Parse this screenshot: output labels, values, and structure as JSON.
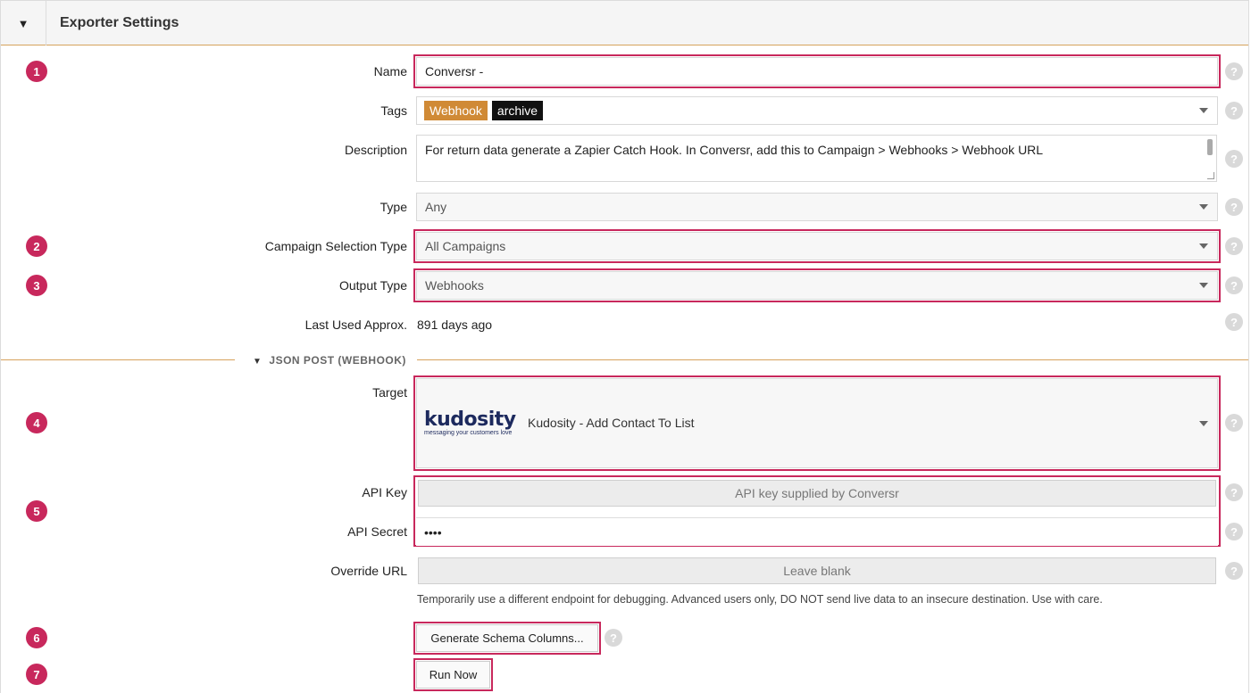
{
  "header": {
    "title": "Exporter Settings",
    "collapse_icon": "▼"
  },
  "badges": [
    "1",
    "2",
    "3",
    "4",
    "5",
    "6",
    "7"
  ],
  "help_icon": "?",
  "form": {
    "name": {
      "label": "Name",
      "value": "Conversr  -"
    },
    "tags": {
      "label": "Tags",
      "items": [
        "Webhook",
        "archive"
      ]
    },
    "description": {
      "label": "Description",
      "value": "For return data generate a Zapier Catch Hook. In Conversr, add this to Campaign > Webhooks > Webhook URL"
    },
    "type": {
      "label": "Type",
      "value": "Any"
    },
    "campaign_selection_type": {
      "label": "Campaign Selection Type",
      "value": "All Campaigns"
    },
    "output_type": {
      "label": "Output Type",
      "value": "Webhooks"
    },
    "last_used": {
      "label": "Last Used Approx.",
      "value": "891 days ago"
    }
  },
  "section": {
    "title": "JSON POST (WEBHOOK)",
    "toggle_icon": "▼",
    "target": {
      "label": "Target",
      "logo_word": "kudosity",
      "logo_tagline": "messaging your customers love",
      "value": "Kudosity - Add Contact To List"
    },
    "api_key": {
      "label": "API Key",
      "placeholder": "API key supplied by Conversr"
    },
    "api_secret": {
      "label": "API Secret",
      "value": "••••"
    },
    "override_url": {
      "label": "Override URL",
      "placeholder": "Leave blank",
      "hint": "Temporarily use a different endpoint for debugging. Advanced users only, DO NOT send live data to an insecure destination. Use with care."
    }
  },
  "buttons": {
    "generate_schema": "Generate Schema Columns...",
    "run_now": "Run Now"
  },
  "colors": {
    "accent": "#c8285c",
    "divider": "#d6a25c",
    "tag_webhook": "#d08a36",
    "tag_archive": "#111111"
  }
}
